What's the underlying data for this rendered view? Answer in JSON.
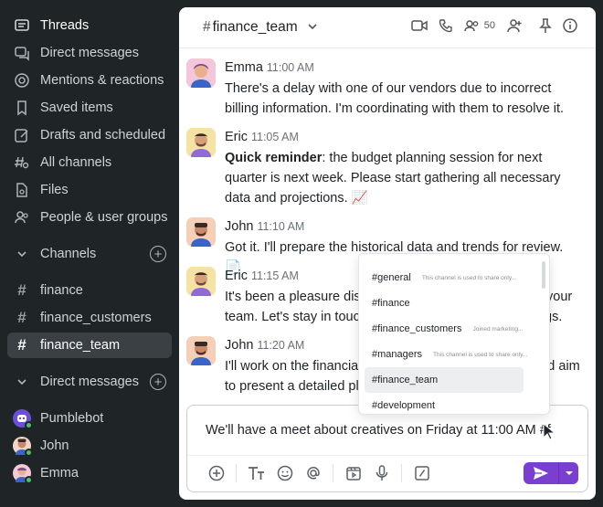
{
  "sidebar": {
    "nav": [
      {
        "label": "Threads",
        "icon": "threads-icon"
      },
      {
        "label": "Direct messages",
        "icon": "direct-messages-icon"
      },
      {
        "label": "Mentions & reactions",
        "icon": "at-icon"
      },
      {
        "label": "Saved items",
        "icon": "bookmark-icon"
      },
      {
        "label": "Drafts and scheduled",
        "icon": "edit-icon"
      },
      {
        "label": "All channels",
        "icon": "channel-search-icon"
      },
      {
        "label": "Files",
        "icon": "file-search-icon"
      },
      {
        "label": "People & user groups",
        "icon": "people-icon"
      }
    ],
    "channels_label": "Channels",
    "channels": [
      "finance",
      "finance_customers",
      "finance_team"
    ],
    "dm_label": "Direct messages",
    "dms": [
      "Pumblebot",
      "John",
      "Emma"
    ]
  },
  "header": {
    "channel": "finance_team",
    "hash": "#",
    "member_count": "50"
  },
  "messages": [
    {
      "author": "Emma",
      "time": "11:00 AM",
      "text": "There's a delay with one of our vendors due to incorrect billing information. I'm coordinating with them to resolve it."
    },
    {
      "author": "Eric",
      "time": "11:05 AM",
      "bold": "Quick reminder",
      "text": ": the budget planning session for next quarter is next week. Please start gathering all necessary data and projections. 📈"
    },
    {
      "author": "John",
      "time": "11:10 AM",
      "text": "Got it. I'll prepare the historical data and trends for review. 📄"
    },
    {
      "author": "Eric",
      "time": "11:15 AM",
      "text_a": "It's been a pleasure disc",
      "text_b": "your",
      "text_c": "team. Let's stay in touc",
      "text_d": "gs."
    },
    {
      "author": "John",
      "time": "11:20 AM",
      "text_a": "I'll work on the financial",
      "text_b": "uld aim",
      "text_c": "to present a detailed pla"
    }
  ],
  "dropdown": [
    {
      "name": "#general",
      "desc": "This channel is used to share only..."
    },
    {
      "name": "#finance",
      "desc": ""
    },
    {
      "name": "#finance_customers",
      "desc": "Joined marketing..."
    },
    {
      "name": "#managers",
      "desc": "This channel is used to share only..."
    },
    {
      "name": "#finance_team",
      "desc": ""
    },
    {
      "name": "#development",
      "desc": ""
    }
  ],
  "composer": {
    "text": "We'll have a meet about creatives  on Friday at 11:00 AM #f"
  },
  "colors": {
    "sidebar_bg": "#1f2426",
    "accent": "#7a3fd1",
    "online": "#4fbf67"
  }
}
